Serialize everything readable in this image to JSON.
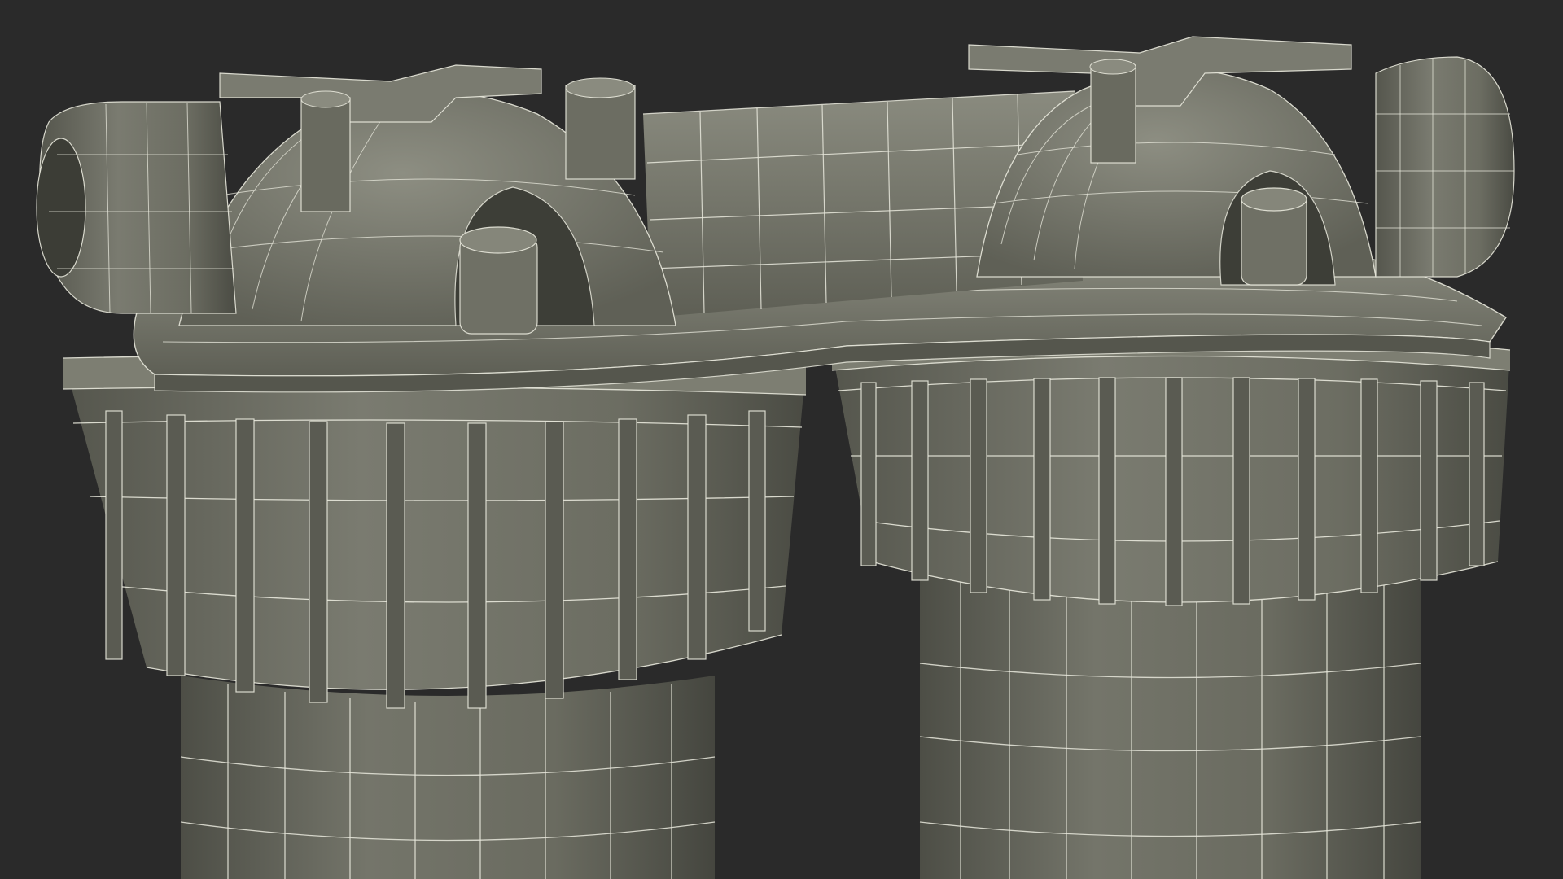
{
  "scene": {
    "subject": "twin-water-filter-housing-wireframe",
    "background_color": "#2a2a2a",
    "material_color": "#6e6f64",
    "material_shadow": "#4b4c44",
    "material_highlight": "#8a8b7f",
    "wire_color": "#e8e8dc"
  }
}
